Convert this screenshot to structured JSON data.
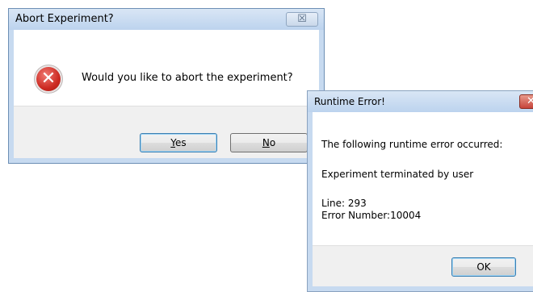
{
  "abort_dialog": {
    "title": "Abort Experiment?",
    "close_glyph": "☒",
    "message": "Would you like to abort the experiment?",
    "icon": "error-x-icon",
    "yes_mnemonic": "Y",
    "yes_rest": "es",
    "no_mnemonic": "N",
    "no_rest": "o"
  },
  "runtime_dialog": {
    "title": "Runtime Error!",
    "close_glyph": "✕",
    "line1": "The following runtime error occurred:",
    "line2": "Experiment terminated by user",
    "line3": "Line: 293",
    "line4": "Error Number:10004",
    "ok_label": "OK"
  },
  "colors": {
    "titlebar": "#c7daf0",
    "close_red": "#c7443a",
    "focus_border": "#3c7fb1"
  }
}
